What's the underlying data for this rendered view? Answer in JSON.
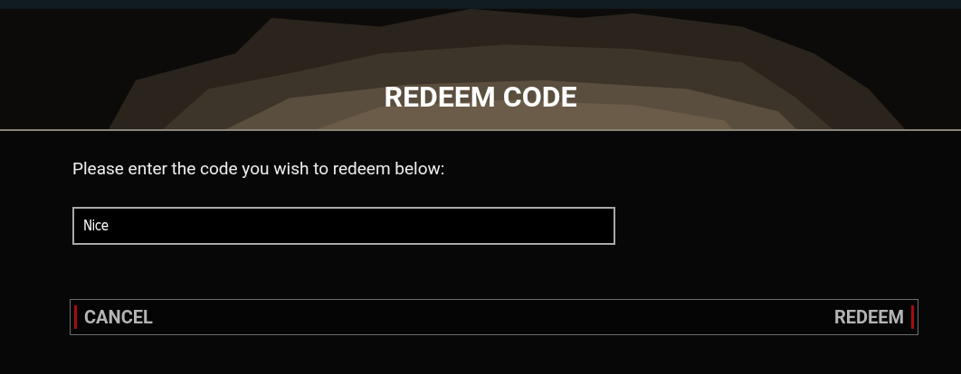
{
  "dialog": {
    "title": "REDEEM CODE",
    "prompt": "Please enter the code you wish to redeem below:",
    "code_field": {
      "value": "Nice"
    },
    "buttons": [
      {
        "kind": "cancel",
        "label": "CANCEL"
      },
      {
        "kind": "confirm",
        "label": "REDEEM"
      }
    ]
  }
}
